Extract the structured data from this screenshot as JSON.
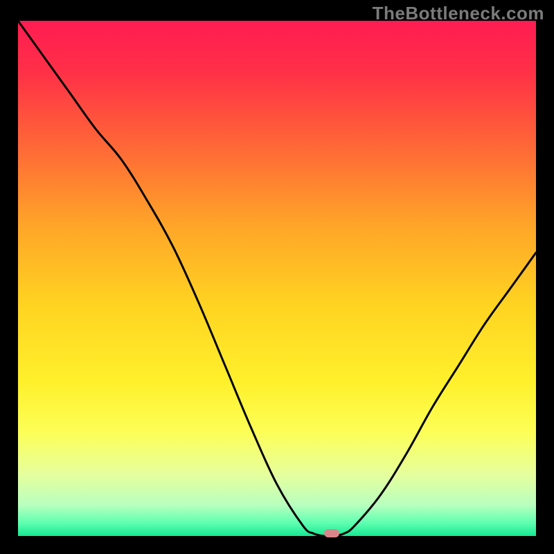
{
  "watermark": "TheBottleneck.com",
  "colors": {
    "black": "#000000",
    "curve": "#000000",
    "marker": "#d9868b",
    "watermark": "#7b7b7b"
  },
  "gradient_stops": [
    {
      "offset": 0.0,
      "color": "#ff1c52"
    },
    {
      "offset": 0.1,
      "color": "#ff3047"
    },
    {
      "offset": 0.25,
      "color": "#ff6a36"
    },
    {
      "offset": 0.4,
      "color": "#ffa628"
    },
    {
      "offset": 0.55,
      "color": "#ffd321"
    },
    {
      "offset": 0.7,
      "color": "#fff02b"
    },
    {
      "offset": 0.8,
      "color": "#fcff58"
    },
    {
      "offset": 0.88,
      "color": "#e6ff9d"
    },
    {
      "offset": 0.94,
      "color": "#b8ffbf"
    },
    {
      "offset": 0.975,
      "color": "#5dffb0"
    },
    {
      "offset": 1.0,
      "color": "#16e892"
    }
  ],
  "chart_data": {
    "type": "line",
    "title": "",
    "xlabel": "",
    "ylabel": "",
    "xlim": [
      0,
      100
    ],
    "ylim": [
      0,
      100
    ],
    "grid": false,
    "legend": false,
    "x": [
      0,
      5,
      10,
      15,
      20,
      25,
      30,
      35,
      40,
      45,
      50,
      55,
      57,
      59,
      61,
      63,
      65,
      70,
      75,
      80,
      85,
      90,
      95,
      100
    ],
    "values": [
      100,
      93,
      86,
      79,
      73,
      65,
      56,
      45,
      33,
      21,
      10,
      2,
      0.5,
      0,
      0,
      0.5,
      2,
      8,
      16,
      25,
      33,
      41,
      48,
      55
    ],
    "flat_segment_x": [
      57,
      63
    ],
    "minimum_x": 60.5,
    "marker": {
      "x": 60.5,
      "y": 0
    },
    "annotations": []
  }
}
